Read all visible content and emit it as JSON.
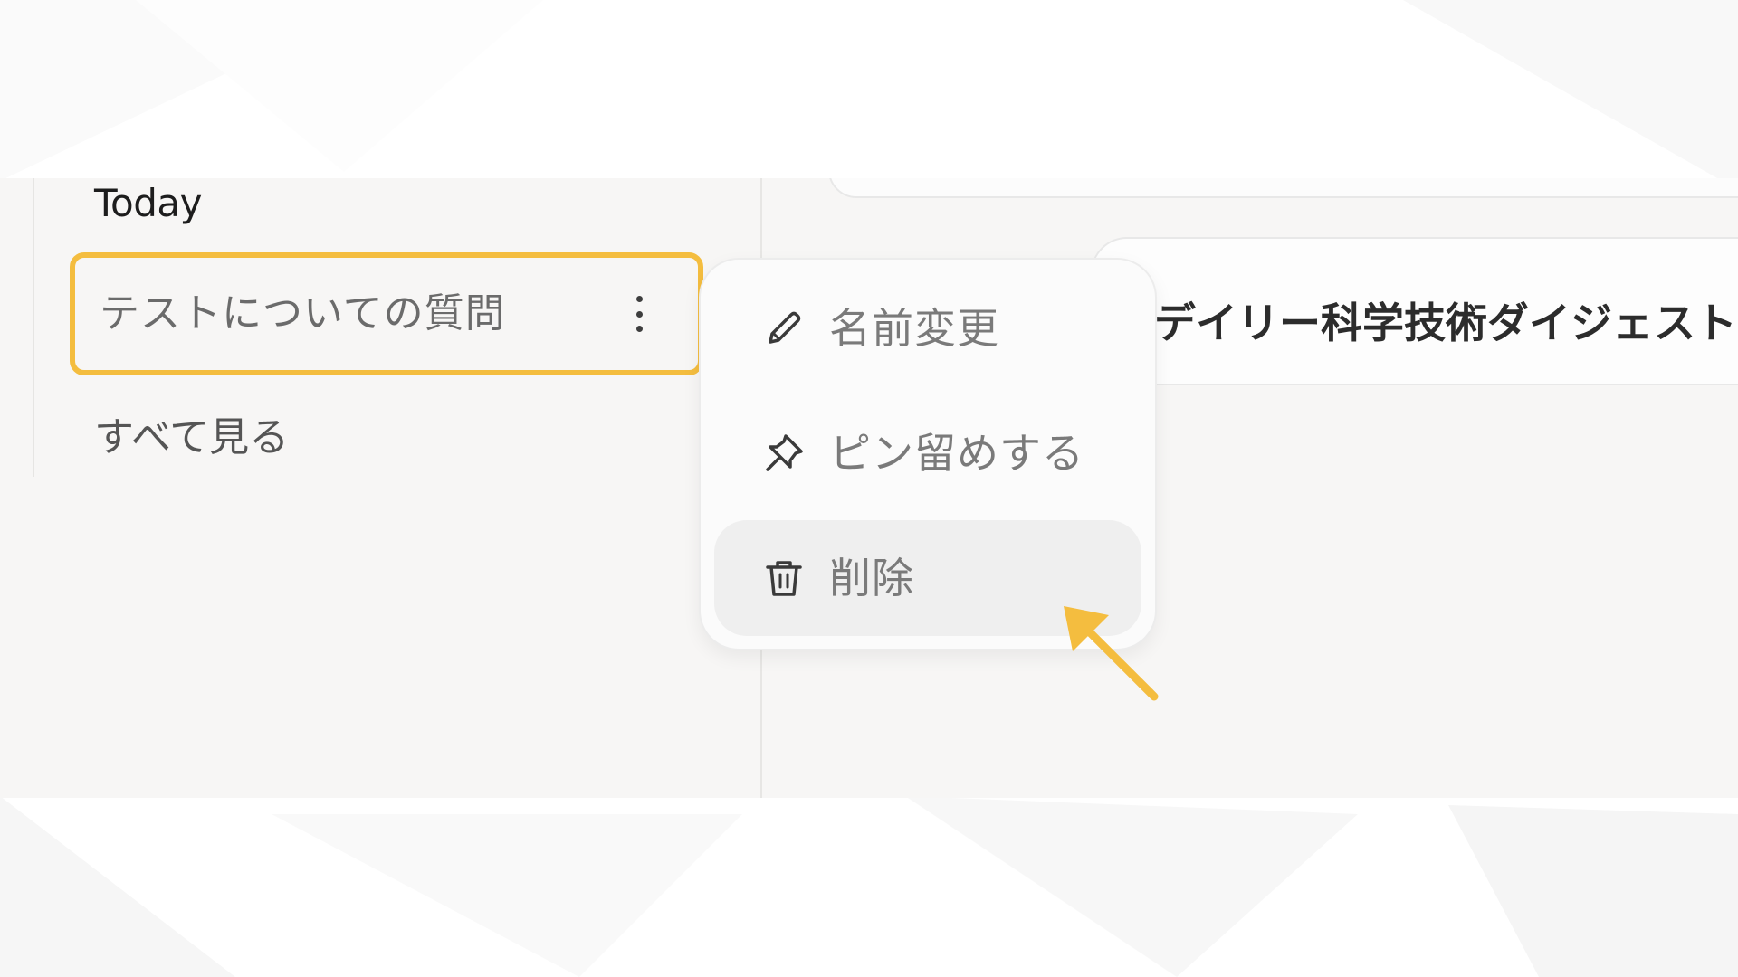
{
  "sidebar": {
    "section_label": "Today",
    "conversation": {
      "title": "テストについての質問",
      "more_icon": "kebab-vertical-icon"
    },
    "see_all_label": "すべて見る"
  },
  "context_menu": {
    "items": [
      {
        "label": "名前変更",
        "icon": "pencil-icon"
      },
      {
        "label": "ピン留めする",
        "icon": "pin-icon"
      },
      {
        "label": "削除",
        "icon": "trash-icon",
        "highlighted": true
      }
    ]
  },
  "main": {
    "suggestion_text": "デイリー科学技術ダイジェストを"
  },
  "annotations": {
    "highlight_color": "#f4bd3f",
    "arrow_color": "#f4bd3f",
    "arrow_icon": "pointer-arrow-icon"
  }
}
